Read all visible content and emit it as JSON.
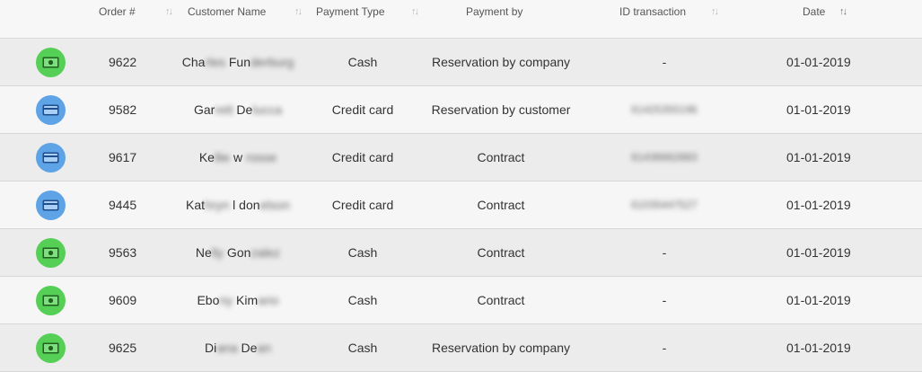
{
  "headers": {
    "order": "Order #",
    "customer": "Customer Name",
    "payment_type": "Payment Type",
    "payment_by": "Payment by",
    "id_transaction": "ID transaction",
    "date": "Date"
  },
  "sort_icons": {
    "neutral": "↑↓",
    "asc": "↑↓"
  },
  "colors": {
    "cash_icon": "#55cf55",
    "card_icon": "#5ea3e6"
  },
  "rows": [
    {
      "icon": "cash-icon",
      "order": "9622",
      "name_visible_1": "Cha",
      "name_blur_1": "rles",
      "name_visible_2": " Fun",
      "name_blur_2": "derburg",
      "payment_type": "Cash",
      "payment_by": "Reservation by company",
      "id_transaction": "-",
      "id_blurred": false,
      "date": "01-01-2019"
    },
    {
      "icon": "credit-card-icon",
      "order": "9582",
      "name_visible_1": "Gar",
      "name_blur_1": "rett",
      "name_visible_2": " De",
      "name_blur_2": "lucca",
      "payment_type": "Credit card",
      "payment_by": "Reservation by customer",
      "id_transaction": "61425355196",
      "id_blurred": true,
      "date": "01-01-2019"
    },
    {
      "icon": "credit-card-icon",
      "order": "9617",
      "name_visible_1": "Ke",
      "name_blur_1": "llie",
      "name_visible_2": " w",
      "name_blur_2": " rosse",
      "payment_type": "Credit card",
      "payment_by": "Contract",
      "id_transaction": "61436662883",
      "id_blurred": true,
      "date": "01-01-2019"
    },
    {
      "icon": "credit-card-icon",
      "order": "9445",
      "name_visible_1": "Kat",
      "name_blur_1": "hryn",
      "name_visible_2": " l don",
      "name_blur_2": "elson",
      "payment_type": "Credit card",
      "payment_by": "Contract",
      "id_transaction": "61035447527",
      "id_blurred": true,
      "date": "01-01-2019"
    },
    {
      "icon": "cash-icon",
      "order": "9563",
      "name_visible_1": "Ne",
      "name_blur_1": "lly",
      "name_visible_2": " Gon",
      "name_blur_2": "zalez",
      "payment_type": "Cash",
      "payment_by": "Contract",
      "id_transaction": "-",
      "id_blurred": false,
      "date": "01-01-2019"
    },
    {
      "icon": "cash-icon",
      "order": "9609",
      "name_visible_1": "Ebo",
      "name_blur_1": "ny",
      "name_visible_2": " Kim",
      "name_blur_2": "ario",
      "payment_type": "Cash",
      "payment_by": "Contract",
      "id_transaction": "-",
      "id_blurred": false,
      "date": "01-01-2019"
    },
    {
      "icon": "cash-icon",
      "order": "9625",
      "name_visible_1": "Di",
      "name_blur_1": "ana",
      "name_visible_2": " De",
      "name_blur_2": "an",
      "payment_type": "Cash",
      "payment_by": "Reservation by company",
      "id_transaction": "-",
      "id_blurred": false,
      "date": "01-01-2019"
    }
  ]
}
